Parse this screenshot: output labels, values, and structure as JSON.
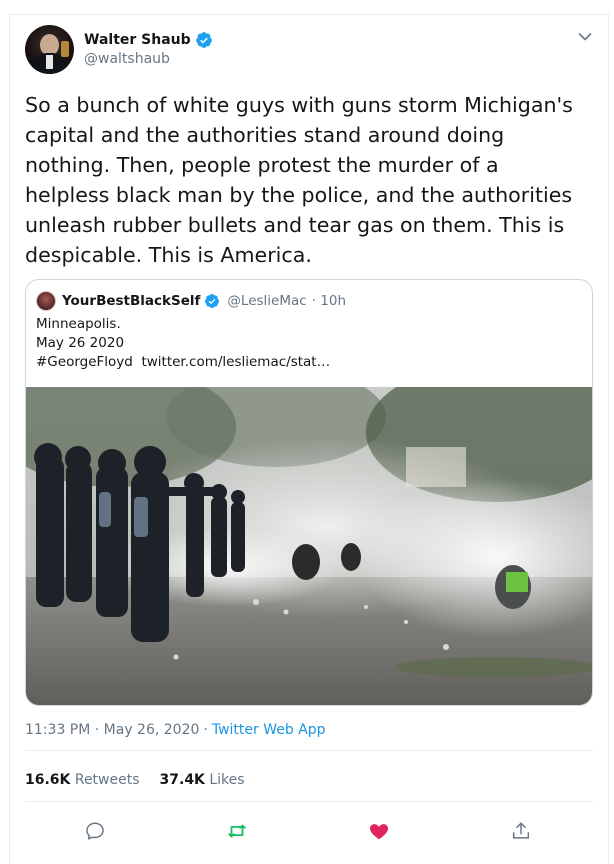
{
  "author": {
    "name": "Walter Shaub",
    "handle": "@waltshaub",
    "verified": true
  },
  "tweet": {
    "text": "So a bunch of white guys with guns storm Michigan's capital and the authorities stand around doing nothing. Then, people protest the murder of a helpless black man by the police, and the authorities unleash rubber bullets and tear gas on them. This is despicable. This is America."
  },
  "quoted_tweet": {
    "name": "YourBestBlackSelf",
    "handle": "@LeslieMac",
    "time": "· 10h",
    "verified": true,
    "lines": [
      "Minneapolis.",
      "May 26 2020",
      "#GeorgeFloyd  twitter.com/lesliemac/stat…"
    ]
  },
  "meta": {
    "time": "11:33 PM · May 26, 2020",
    "separator": "·",
    "app": "Twitter Web App"
  },
  "stats": {
    "retweets_count": "16.6K",
    "retweets_label": "Retweets",
    "likes_count": "37.4K",
    "likes_label": "Likes"
  },
  "actions": {
    "reply_icon": "reply-icon",
    "retweet_icon": "retweet-icon",
    "like_icon": "heart-icon",
    "share_icon": "share-icon"
  },
  "colors": {
    "accent": "#1da1f2",
    "retweet_active": "#17bf63",
    "like_active": "#e0245e",
    "secondary_text": "#657786"
  }
}
